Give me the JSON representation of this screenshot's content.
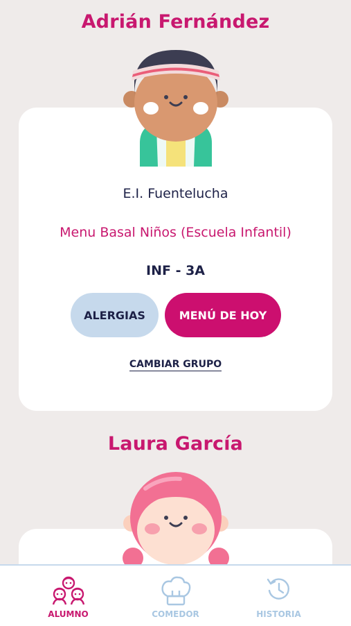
{
  "students": [
    {
      "name": "Adrián Fernández",
      "school": "E.I. Fuentelucha",
      "menu": "Menu Basal Niños (Escuela Infantil)",
      "group": "INF - 3A",
      "allergies_label": "ALERGIAS",
      "today_menu_label": "MENÚ DE HOY",
      "change_group_label": "CAMBIAR GRUPO",
      "avatar_icon": "boy-avatar-icon"
    },
    {
      "name": "Laura García",
      "avatar_icon": "girl-avatar-icon"
    }
  ],
  "bottom_nav": {
    "items": [
      {
        "label": "ALUMNO",
        "icon": "children-icon",
        "active": true
      },
      {
        "label": "COMEDOR",
        "icon": "chef-hat-icon",
        "active": false
      },
      {
        "label": "HISTORIA",
        "icon": "history-icon",
        "active": false
      }
    ]
  },
  "colors": {
    "accent": "#c8186f",
    "button_primary": "#cc0f6f",
    "button_secondary": "#c6d9ec",
    "text_dark": "#1d2147",
    "background": "#efebea",
    "nav_inactive": "#a9c7e2"
  }
}
